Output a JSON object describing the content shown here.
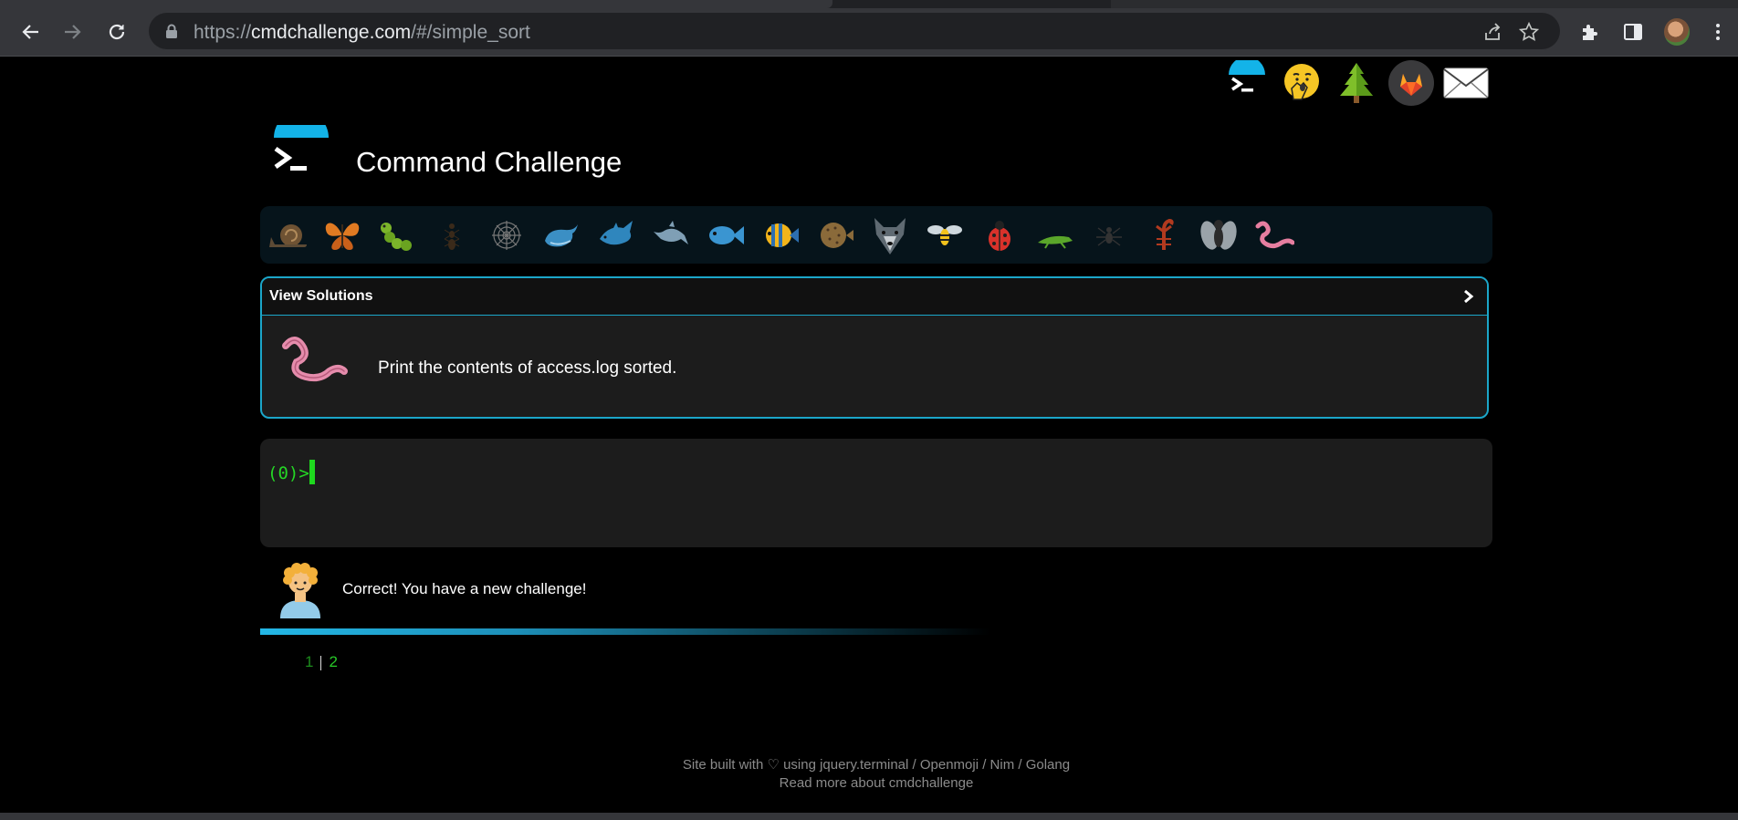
{
  "browser": {
    "url_scheme": "https://",
    "url_host": "cmdchallenge.com",
    "url_path": "/#/simple_sort"
  },
  "header": {
    "title": "Command Challenge"
  },
  "top_icons": [
    "cmd-logo-icon",
    "hand-over-mouth-face-icon",
    "tree-icon",
    "gitlab-icon",
    "envelope-icon"
  ],
  "animals": [
    "snail",
    "butterfly",
    "caterpillar",
    "ant",
    "spider-web",
    "whale",
    "shark",
    "dolphin",
    "fish",
    "tropical-fish",
    "blowfish",
    "wolf",
    "wasp",
    "ladybug",
    "cricket",
    "spider",
    "scorpion",
    "fly",
    "worm"
  ],
  "challenge": {
    "view_solutions_label": "View Solutions",
    "description": "Print the contents of access.log sorted."
  },
  "terminal": {
    "prompt": "(0)>"
  },
  "status": {
    "message": "Correct! You have a new challenge!"
  },
  "pager": {
    "page1": "1",
    "page2": "2"
  },
  "footer": {
    "line1": "Site built with ♡ using jquery.terminal / Openmoji / Nim / Golang",
    "line2": "Read more about cmdchallenge"
  },
  "colors": {
    "accent": "#1ba6c9",
    "terminal_green": "#25d625",
    "background": "#000000"
  }
}
